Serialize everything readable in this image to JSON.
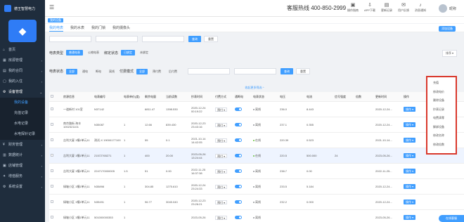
{
  "brand": {
    "name": "德王智慧电力"
  },
  "header": {
    "hotline": "客服热线 400-850-2999",
    "actions": [
      {
        "label": "操作指南",
        "icon": "guide-icon"
      },
      {
        "label": "APP下载",
        "icon": "download-icon"
      },
      {
        "label": "更新记录",
        "icon": "record-icon"
      },
      {
        "label": "用户反馈",
        "icon": "feedback-icon"
      },
      {
        "label": "消息通知",
        "icon": "bell-icon"
      }
    ],
    "user": "昵称"
  },
  "sidebar": {
    "items": [
      {
        "label": "首页",
        "icon": "home-icon"
      },
      {
        "label": "房源管理",
        "icon": "house-icon"
      },
      {
        "label": "我的合同",
        "icon": "contract-icon"
      },
      {
        "label": "我的入住",
        "icon": "checkin-icon"
      },
      {
        "label": "设备管理",
        "icon": "device-icon"
      }
    ],
    "sub_items": [
      "我的设备",
      "充值记录",
      "水电记录",
      "水电探针记录"
    ],
    "items_after": [
      {
        "label": "财务管理",
        "icon": "finance-icon"
      },
      {
        "label": "数据统计",
        "icon": "stats-icon"
      },
      {
        "label": "店铺管理",
        "icon": "store-icon"
      },
      {
        "label": "增值服务",
        "icon": "service-icon"
      },
      {
        "label": "系统设置",
        "icon": "settings-icon"
      }
    ]
  },
  "tagbar": {
    "tag": "我的设备"
  },
  "tabs": [
    "我的电表",
    "我的水表",
    "我的门锁",
    "我的摄像头"
  ],
  "add_button": "添加设备",
  "filters": {
    "input1_placeholder": "",
    "input2_placeholder": "",
    "input3_placeholder": "",
    "search": "查询",
    "reset": "重置",
    "meter_type_label": "电表类型",
    "meter_types": [
      "普通电表",
      "公摊电表"
    ],
    "bind_status_label": "绑定状态",
    "bind_status": [
      "已绑定",
      "未绑定"
    ],
    "sort": "排序 ▾",
    "meter_status_label": "电表状态",
    "meter_status": [
      "全部",
      "通电",
      "断电",
      "离线"
    ],
    "pay_mode_label": "付费模式",
    "pay_mode": [
      "全部",
      "预付费",
      "后付费"
    ],
    "more": "收起更多筛选 ^"
  },
  "table": {
    "columns": [
      "房源信息",
      "电表编号",
      "电表单价(度)",
      "剩余电量",
      "当前读数",
      "抄表时间",
      "付费方式",
      "通断电",
      "电表状态",
      "电压",
      "电流",
      "信号强度",
      "倍数",
      "更新时间",
      "操作"
    ],
    "rows": [
      {
        "house": "一道新村 101室",
        "no": "N37142",
        "price": "",
        "remain": "6811.47",
        "reading": "1398.530",
        "time": "2020-12-24 00:19:22",
        "pay": "预付",
        "status": "离线",
        "voltage": "236.0",
        "current": "8.443",
        "signal": "",
        "ratio": "",
        "updated": "2020-12-24...",
        "op": "操作"
      },
      {
        "house": "南京路街 海丰1002321101",
        "no": "N35087",
        "price": "1",
        "remain": "12.66",
        "reading": "839.430",
        "time": "2020-12-23 23:43:16",
        "pay": "预付",
        "status": "离线",
        "voltage": "237.1",
        "current": "0.355",
        "signal": "",
        "ratio": "",
        "updated": "2020-12-24...",
        "op": "操作"
      },
      {
        "house": "吉利大厦 1幢1单元11",
        "no": "测试-X 19000177100",
        "price": "1",
        "remain": "55",
        "reading": "0.1",
        "time": "2021-10-14 14:42:05",
        "pay": "预付",
        "status": "在线",
        "voltage": "220.39",
        "current": "0.523",
        "signal": "",
        "ratio": "",
        "updated": "2021-10-14...",
        "op": "操作"
      },
      {
        "house": "吉利大厦 1幢1单元11",
        "no": "21572765271",
        "price": "1",
        "remain": "400",
        "reading": "20.00",
        "time": "2023-05-26 13:24:44",
        "pay": "预付",
        "status": "在线",
        "voltage": "220.5",
        "current": "500.000",
        "signal": "24",
        "ratio": "",
        "updated": "2023-05-26...",
        "op": "操作"
      },
      {
        "house": "吉利大厦 1幢1单元11",
        "no": "2247170000005",
        "price": "1.5",
        "remain": "51",
        "reading": "0.00",
        "time": "2022-11-25 16:37:38",
        "pay": "预付",
        "status": "离线",
        "voltage": "238.7",
        "current": "0.00",
        "signal": "",
        "ratio": "",
        "updated": "2022-11-25...",
        "op": "操作"
      },
      {
        "house": "绿轴小区 1幢1单元11",
        "no": "N35898",
        "price": "1",
        "remain": "304.85",
        "reading": "1275.610",
        "time": "2020-12-24 23:24:33",
        "pay": "预付",
        "status": "离线",
        "voltage": "233.5",
        "current": "5.184",
        "signal": "",
        "ratio": "",
        "updated": "2020-12-24...",
        "op": "操作"
      },
      {
        "house": "绿轴小区 1幢1单元11",
        "no": "N35491",
        "price": "1",
        "remain": "96.77",
        "reading": "3045.040",
        "time": "2020-12-23 23:26:21",
        "pay": "预付",
        "status": "离线",
        "voltage": "232.2",
        "current": "0.000",
        "signal": "",
        "ratio": "",
        "updated": "2020-12-24...",
        "op": "操作"
      },
      {
        "house": "绿轴小区 1幢1单元11",
        "no": "501000000353",
        "price": "1",
        "remain": "",
        "reading": "",
        "time": "2023-05-26",
        "pay": "预付",
        "status": "离线",
        "voltage": "",
        "current": "",
        "signal": "",
        "ratio": "",
        "updated": "2023-05-26...",
        "op": "操作"
      }
    ]
  },
  "dropdown": [
    "充值",
    "修改电价",
    "删除设备",
    "抄表记录",
    "电费清零",
    "解绑设备",
    "修改名称",
    "修改倍数"
  ],
  "online_service": "在线客服",
  "colors": {
    "accent": "#409eff",
    "sidebar": "#1f2d3d",
    "highlight_border": "#d9382c"
  }
}
